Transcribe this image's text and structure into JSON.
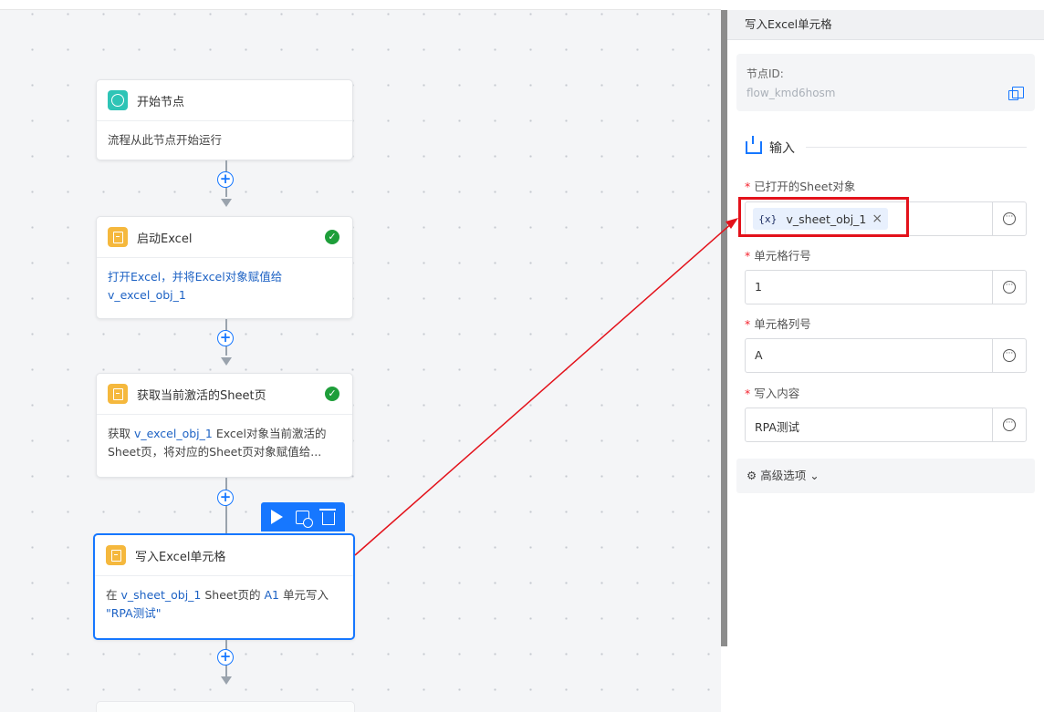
{
  "canvas": {
    "nodes": [
      {
        "title": "开始节点",
        "icon": "start-circle-icon",
        "status": "",
        "body": "流程从此节点开始运行"
      },
      {
        "title": "启动Excel",
        "icon": "excel-icon",
        "status": "success",
        "body_prefix": "打开Excel，并将Excel对象赋值给",
        "body_var": "v_excel_obj_1"
      },
      {
        "title": "获取当前激活的Sheet页",
        "icon": "excel-icon",
        "status": "success",
        "body_prefix": "获取",
        "body_var": "v_excel_obj_1",
        "body_suffix": "Excel对象当前激活的Sheet页，将对应的Sheet页对象赋值给..."
      },
      {
        "title": "写入Excel单元格",
        "icon": "excel-icon",
        "status": "selected",
        "body_prefix": "在",
        "body_var": "v_sheet_obj_1",
        "body_mid": "Sheet页的",
        "body_cell": "A1",
        "body_after": "单元写入",
        "body_value": "\"RPA测试\""
      }
    ],
    "add_button_glyph": "+",
    "toolbar": {
      "run": "run-icon",
      "disable": "disable-icon",
      "delete": "trash-icon"
    }
  },
  "panel": {
    "title": "写入Excel单元格",
    "node_id_label": "节点ID:",
    "node_id_value": "flow_kmd6hosm",
    "section_title": "输入",
    "fields": [
      {
        "label": "已打开的Sheet对象",
        "required": true,
        "type": "tag",
        "tag_prefix": "{x}",
        "value": "v_sheet_obj_1"
      },
      {
        "label": "单元格行号",
        "required": true,
        "value": "1"
      },
      {
        "label": "单元格列号",
        "required": true,
        "value": "A"
      },
      {
        "label": "写入内容",
        "required": true,
        "value": "RPA测试"
      }
    ],
    "advanced_label": "高级选项"
  },
  "colors": {
    "accent": "#1677ff",
    "success": "#1e9e3a",
    "annotation": "#e3121b",
    "excel": "#f5b83d",
    "start": "#2ec4b6"
  }
}
